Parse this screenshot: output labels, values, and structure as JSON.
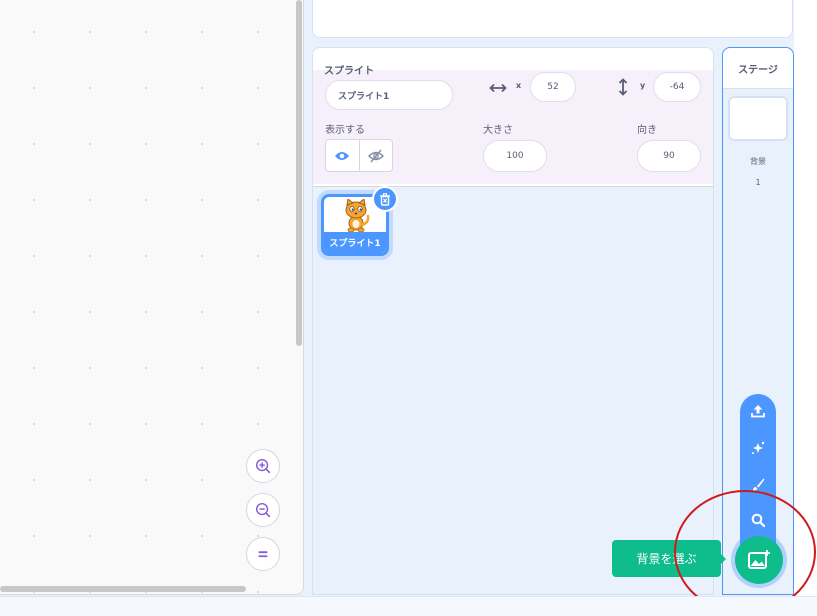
{
  "sprite_info": {
    "title": "スプライト",
    "name_value": "スプライト1",
    "x_label": "x",
    "x_value": "52",
    "y_label": "y",
    "y_value": "-64",
    "show_label": "表示する",
    "size_label": "大きさ",
    "size_value": "100",
    "direction_label": "向き",
    "direction_value": "90"
  },
  "sprites": [
    {
      "name": "スプライト1",
      "selected": true
    }
  ],
  "stage": {
    "title": "ステージ",
    "backdrops_label": "背景",
    "backdrops_count": "1"
  },
  "backdrop_menu": {
    "items": [
      "upload-icon",
      "surprise-icon",
      "paint-icon",
      "search-icon"
    ],
    "tooltip": "背景を選ぶ"
  },
  "workspace": {
    "zoom_buttons": [
      "zoom-in-icon",
      "zoom-out-icon",
      "zoom-reset-icon"
    ]
  },
  "colors": {
    "accent_blue": "#4c97ff",
    "backdrop_green": "#0fbd8c",
    "highlight_red": "#d01a1a"
  }
}
